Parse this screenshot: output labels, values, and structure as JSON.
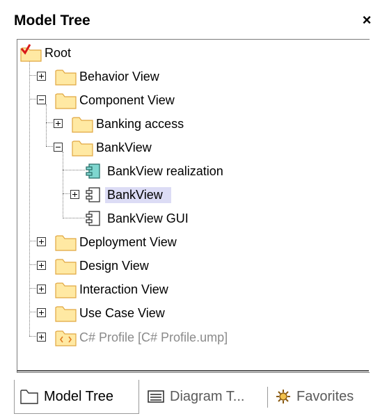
{
  "panel": {
    "title": "Model Tree",
    "close_glyph": "×"
  },
  "tree": {
    "root": "Root",
    "behavior_view": "Behavior View",
    "component_view": "Component View",
    "banking_access": "Banking access",
    "bankview_folder": "BankView",
    "bankview_realization": "BankView realization",
    "bankview_component": "BankView",
    "bankview_gui": "BankView GUI",
    "deployment_view": "Deployment View",
    "design_view": "Design View",
    "interaction_view": "Interaction View",
    "use_case_view": "Use Case View",
    "cs_profile": "C# Profile [C# Profile.ump]"
  },
  "tabs": {
    "model_tree": "Model Tree",
    "diagram_tree": "Diagram T...",
    "favorites": "Favorites"
  },
  "colors": {
    "folder_fill": "#ffe9a3",
    "folder_stroke": "#e0a640",
    "selection": "#dcdcf5",
    "realization_fill": "#7fd6cf",
    "dim_text": "#8a8a8a"
  },
  "icons": {
    "root": "root-folder-icon",
    "folder": "folder-icon",
    "realization": "component-realization-icon",
    "component": "component-icon",
    "profile": "profile-folder-icon",
    "favorites": "favorites-icon",
    "diagram_tree": "diagram-tree-icon"
  }
}
